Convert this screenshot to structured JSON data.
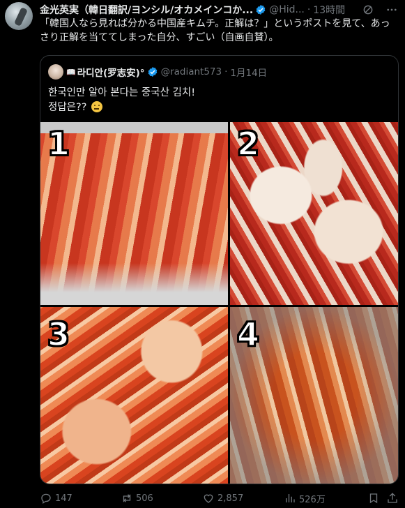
{
  "author": {
    "name": "金光英実（韓日翻訳/ヨンシル/オカメインコか...",
    "handle": "@Hid...",
    "time": "13時間"
  },
  "tweet": {
    "text": "「韓国人なら見れば分かる中国産キムチ。正解は？」というポストを見て、あっさり正解を当ててしまった自分、すごい（自画自賛）。"
  },
  "quote": {
    "name": "라디안(罗志安)°",
    "handle": "@radiant573",
    "time": "1月14日",
    "line1": "한국인만 알아 본다는 중국산 김치!",
    "line2": "정답은??"
  },
  "images": [
    {
      "label": "1"
    },
    {
      "label": "2"
    },
    {
      "label": "3"
    },
    {
      "label": "4"
    }
  ],
  "actions": {
    "replies": "147",
    "retweets": "506",
    "likes": "2,857",
    "views": "526万"
  },
  "colors": {
    "background": "#000000",
    "text": "#e7e9ea",
    "muted": "#71767b",
    "verified": "#1d9bf0",
    "border": "#2f3336"
  },
  "icons": [
    "verified-badge-icon",
    "grok-icon",
    "more-icon",
    "reply-icon",
    "retweet-icon",
    "like-icon",
    "views-icon",
    "bookmark-icon",
    "share-icon"
  ]
}
